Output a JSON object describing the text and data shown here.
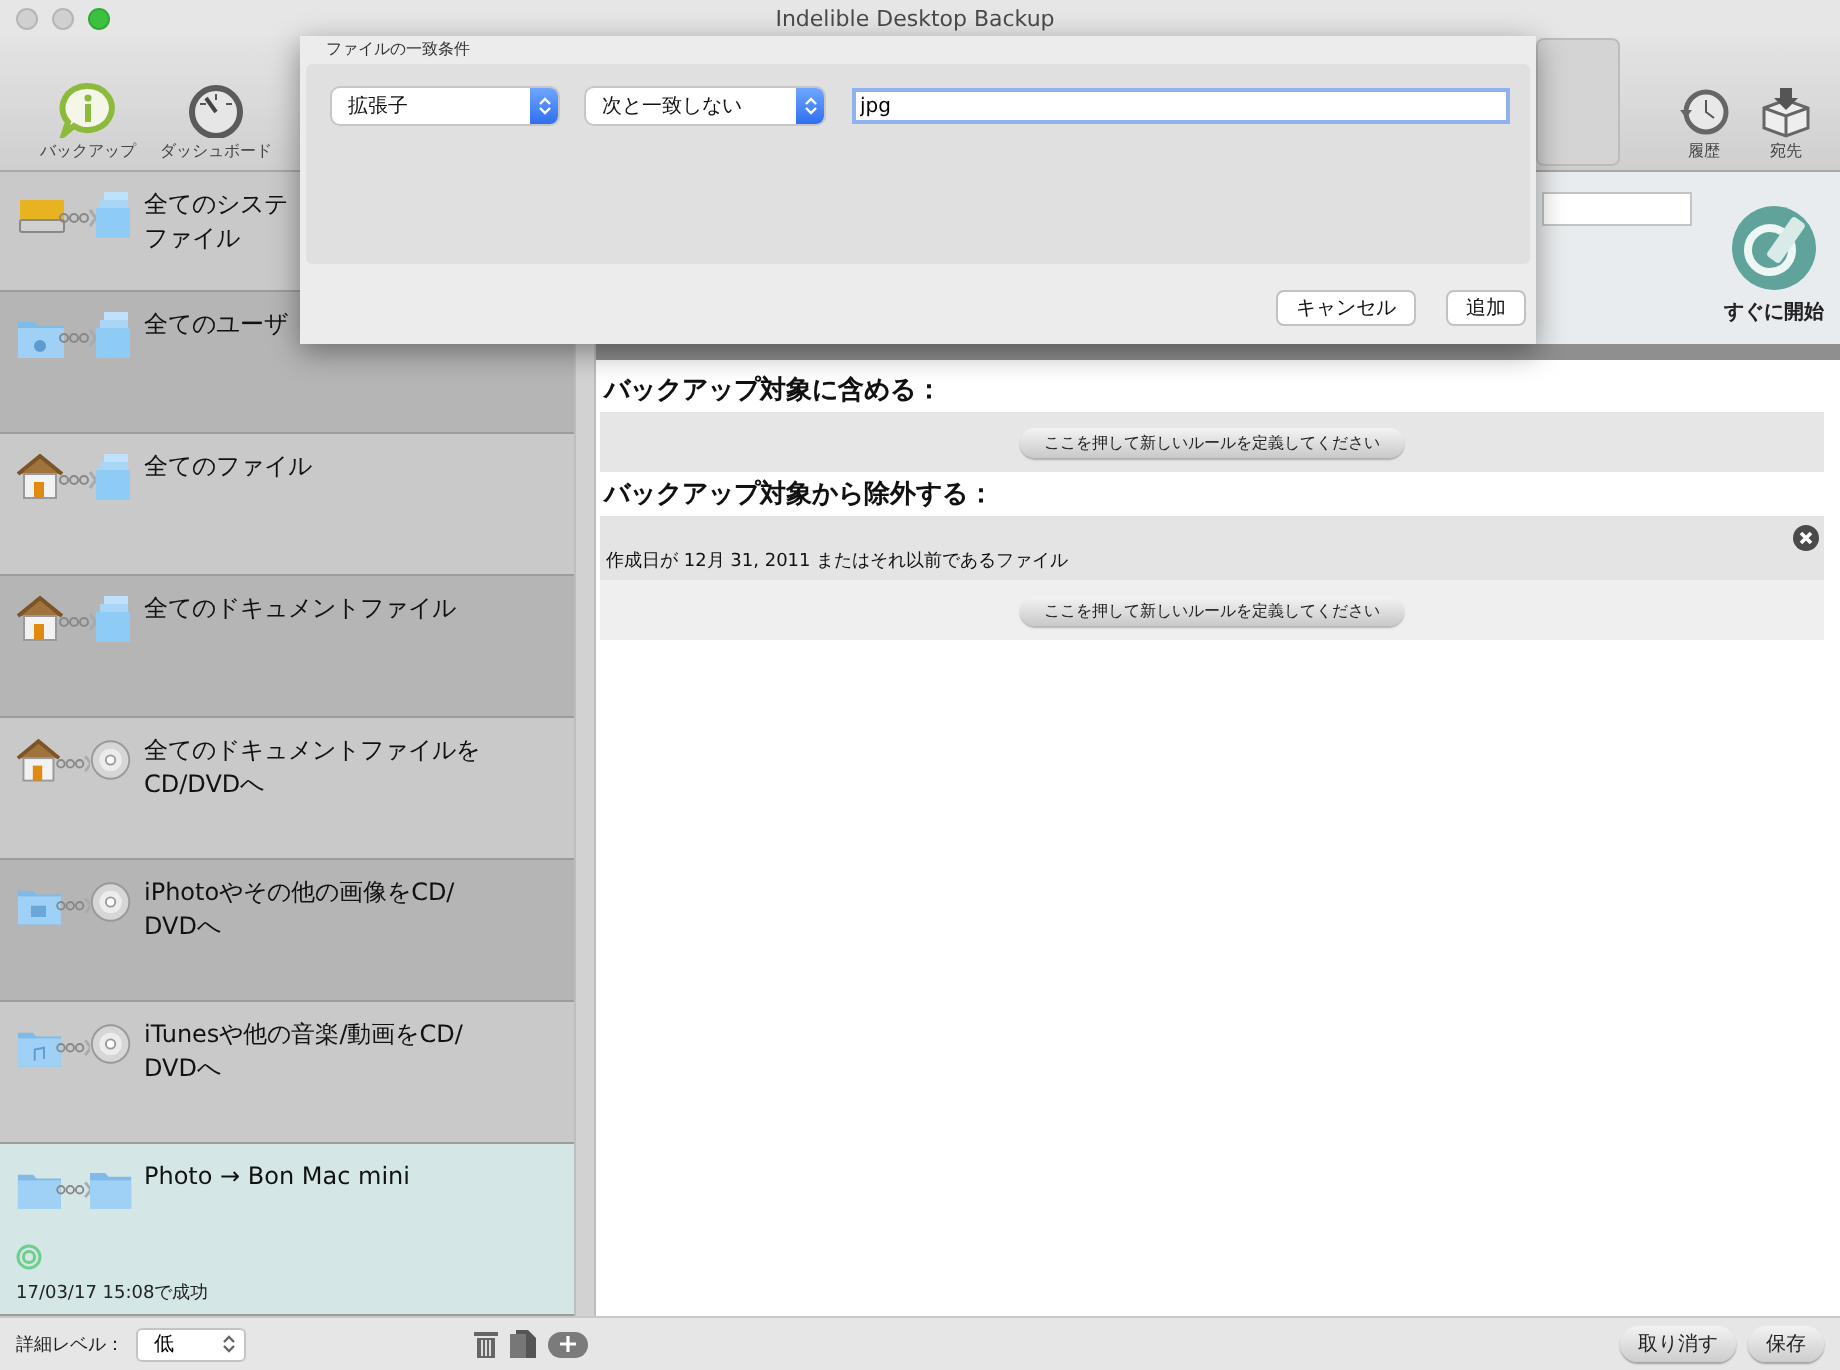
{
  "window": {
    "title": "Indelible Desktop Backup"
  },
  "toolbar": {
    "left": [
      {
        "label": "バックアップ"
      },
      {
        "label": "ダッシュボード"
      }
    ],
    "right": [
      {
        "label": "履歴"
      },
      {
        "label": "宛先"
      }
    ]
  },
  "sidebar": {
    "items": [
      {
        "lines": [
          "全てのシステ",
          "ファイル"
        ],
        "selected": false
      },
      {
        "lines": [
          "全てのユーザ"
        ],
        "selected": false
      },
      {
        "lines": [
          "全てのファイル"
        ],
        "selected": false
      },
      {
        "lines": [
          "全てのドキュメントファイル"
        ],
        "selected": false
      },
      {
        "lines": [
          "全てのドキュメントファイルを",
          "CD/DVDへ"
        ],
        "selected": false
      },
      {
        "lines": [
          "iPhotoやその他の画像をCD/",
          "DVDへ"
        ],
        "selected": false
      },
      {
        "lines": [
          "iTunesや他の音楽/動画をCD/",
          "DVDへ"
        ],
        "selected": false
      },
      {
        "lines": [
          "Photo → Bon Mac mini"
        ],
        "selected": true,
        "status": "17/03/17 15:08で成功"
      }
    ]
  },
  "detail_level": {
    "label": "詳細レベル：",
    "value": "低"
  },
  "start_button": "すぐに開始",
  "include": {
    "heading": "バックアップ対象に含める：",
    "add_button": "ここを押して新しいルールを定義してください"
  },
  "exclude": {
    "heading": "バックアップ対象から除外する：",
    "rules": [
      {
        "text": "作成日が 12月 31, 2011 またはそれ以前であるファイル"
      }
    ],
    "add_button": "ここを押して新しいルールを定義してください"
  },
  "footer_buttons": [
    "取り消す",
    "保存"
  ],
  "sheet": {
    "title": "ファイルの一致条件",
    "attribute": "拡張子",
    "operator": "次と一致しない",
    "value": "jpg",
    "buttons": [
      "キャンセル",
      "追加"
    ]
  }
}
